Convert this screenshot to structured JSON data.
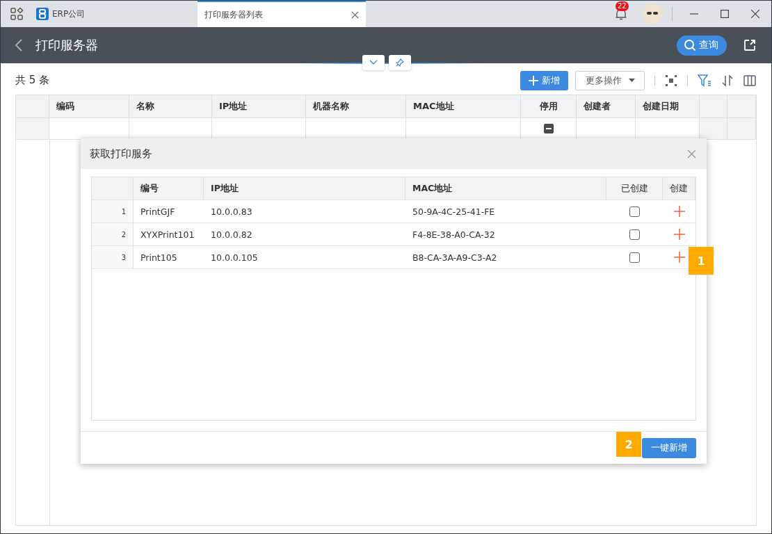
{
  "window": {
    "tabs": [
      {
        "label": "ERP公司",
        "selected": false,
        "kind": "home"
      },
      {
        "label": "打印服务器列表",
        "selected": true,
        "kind": "page"
      }
    ],
    "notifications": {
      "badge": "22"
    }
  },
  "header": {
    "title": "打印服务器",
    "search_button": "查询"
  },
  "toolbar": {
    "count": "共 5 条",
    "add_button": "新增",
    "more_button": "更多操作"
  },
  "table": {
    "columns": [
      {
        "label": "编码",
        "kind": "text"
      },
      {
        "label": "名称",
        "kind": "text"
      },
      {
        "label": "IP地址",
        "kind": "text"
      },
      {
        "label": "机器名称",
        "kind": "text"
      },
      {
        "label": "MAC地址",
        "kind": "text"
      },
      {
        "label": "停用",
        "kind": "check"
      },
      {
        "label": "创建者",
        "kind": "text"
      },
      {
        "label": "创建日期",
        "kind": "text"
      }
    ],
    "filter_row": {
      "disabled_filter": {
        "indeterminate": true
      }
    }
  },
  "dialog": {
    "title": "获取打印服务",
    "columns": [
      {
        "label": "编号",
        "kind": "text"
      },
      {
        "label": "IP地址",
        "kind": "text"
      },
      {
        "label": "MAC地址",
        "kind": "text"
      },
      {
        "label": "已创建",
        "kind": "check"
      },
      {
        "label": "创建",
        "kind": "check"
      }
    ],
    "rows": [
      {
        "index": "1",
        "code": "PrintGJF",
        "ip": "10.0.0.83",
        "mac": "50-9A-4C-25-41-FE",
        "created": false
      },
      {
        "index": "2",
        "code": "XYXPrint101",
        "ip": "10.0.0.82",
        "mac": "F4-8E-38-A0-CA-32",
        "created": false
      },
      {
        "index": "3",
        "code": "Print105",
        "ip": "10.0.0.105",
        "mac": "B8-CA-3A-A9-C3-A2",
        "created": false
      }
    ],
    "confirm_button": "一键新增"
  },
  "annotations": [
    {
      "label": "1"
    },
    {
      "label": "2"
    }
  ]
}
